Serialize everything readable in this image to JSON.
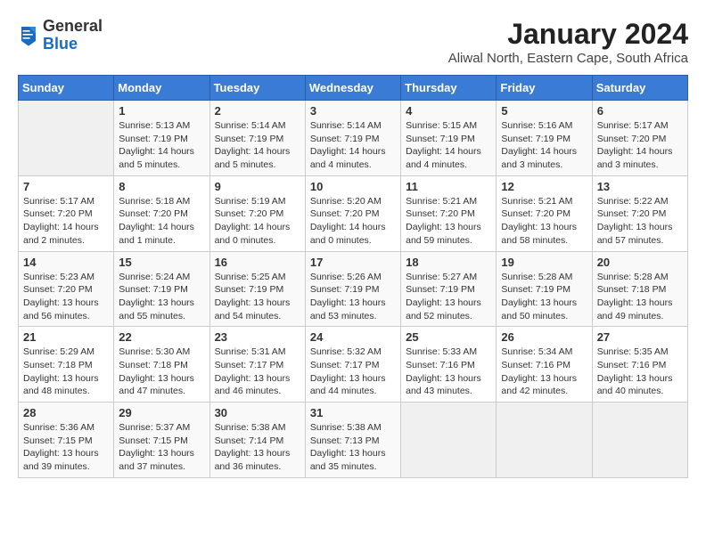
{
  "header": {
    "logo": {
      "line1": "General",
      "line2": "Blue"
    },
    "title": "January 2024",
    "location": "Aliwal North, Eastern Cape, South Africa"
  },
  "calendar": {
    "days_of_week": [
      "Sunday",
      "Monday",
      "Tuesday",
      "Wednesday",
      "Thursday",
      "Friday",
      "Saturday"
    ],
    "weeks": [
      [
        {
          "day": "",
          "info": ""
        },
        {
          "day": "1",
          "info": "Sunrise: 5:13 AM\nSunset: 7:19 PM\nDaylight: 14 hours\nand 5 minutes."
        },
        {
          "day": "2",
          "info": "Sunrise: 5:14 AM\nSunset: 7:19 PM\nDaylight: 14 hours\nand 5 minutes."
        },
        {
          "day": "3",
          "info": "Sunrise: 5:14 AM\nSunset: 7:19 PM\nDaylight: 14 hours\nand 4 minutes."
        },
        {
          "day": "4",
          "info": "Sunrise: 5:15 AM\nSunset: 7:19 PM\nDaylight: 14 hours\nand 4 minutes."
        },
        {
          "day": "5",
          "info": "Sunrise: 5:16 AM\nSunset: 7:19 PM\nDaylight: 14 hours\nand 3 minutes."
        },
        {
          "day": "6",
          "info": "Sunrise: 5:17 AM\nSunset: 7:20 PM\nDaylight: 14 hours\nand 3 minutes."
        }
      ],
      [
        {
          "day": "7",
          "info": "Sunrise: 5:17 AM\nSunset: 7:20 PM\nDaylight: 14 hours\nand 2 minutes."
        },
        {
          "day": "8",
          "info": "Sunrise: 5:18 AM\nSunset: 7:20 PM\nDaylight: 14 hours\nand 1 minute."
        },
        {
          "day": "9",
          "info": "Sunrise: 5:19 AM\nSunset: 7:20 PM\nDaylight: 14 hours\nand 0 minutes."
        },
        {
          "day": "10",
          "info": "Sunrise: 5:20 AM\nSunset: 7:20 PM\nDaylight: 14 hours\nand 0 minutes."
        },
        {
          "day": "11",
          "info": "Sunrise: 5:21 AM\nSunset: 7:20 PM\nDaylight: 13 hours\nand 59 minutes."
        },
        {
          "day": "12",
          "info": "Sunrise: 5:21 AM\nSunset: 7:20 PM\nDaylight: 13 hours\nand 58 minutes."
        },
        {
          "day": "13",
          "info": "Sunrise: 5:22 AM\nSunset: 7:20 PM\nDaylight: 13 hours\nand 57 minutes."
        }
      ],
      [
        {
          "day": "14",
          "info": "Sunrise: 5:23 AM\nSunset: 7:20 PM\nDaylight: 13 hours\nand 56 minutes."
        },
        {
          "day": "15",
          "info": "Sunrise: 5:24 AM\nSunset: 7:19 PM\nDaylight: 13 hours\nand 55 minutes."
        },
        {
          "day": "16",
          "info": "Sunrise: 5:25 AM\nSunset: 7:19 PM\nDaylight: 13 hours\nand 54 minutes."
        },
        {
          "day": "17",
          "info": "Sunrise: 5:26 AM\nSunset: 7:19 PM\nDaylight: 13 hours\nand 53 minutes."
        },
        {
          "day": "18",
          "info": "Sunrise: 5:27 AM\nSunset: 7:19 PM\nDaylight: 13 hours\nand 52 minutes."
        },
        {
          "day": "19",
          "info": "Sunrise: 5:28 AM\nSunset: 7:19 PM\nDaylight: 13 hours\nand 50 minutes."
        },
        {
          "day": "20",
          "info": "Sunrise: 5:28 AM\nSunset: 7:18 PM\nDaylight: 13 hours\nand 49 minutes."
        }
      ],
      [
        {
          "day": "21",
          "info": "Sunrise: 5:29 AM\nSunset: 7:18 PM\nDaylight: 13 hours\nand 48 minutes."
        },
        {
          "day": "22",
          "info": "Sunrise: 5:30 AM\nSunset: 7:18 PM\nDaylight: 13 hours\nand 47 minutes."
        },
        {
          "day": "23",
          "info": "Sunrise: 5:31 AM\nSunset: 7:17 PM\nDaylight: 13 hours\nand 46 minutes."
        },
        {
          "day": "24",
          "info": "Sunrise: 5:32 AM\nSunset: 7:17 PM\nDaylight: 13 hours\nand 44 minutes."
        },
        {
          "day": "25",
          "info": "Sunrise: 5:33 AM\nSunset: 7:16 PM\nDaylight: 13 hours\nand 43 minutes."
        },
        {
          "day": "26",
          "info": "Sunrise: 5:34 AM\nSunset: 7:16 PM\nDaylight: 13 hours\nand 42 minutes."
        },
        {
          "day": "27",
          "info": "Sunrise: 5:35 AM\nSunset: 7:16 PM\nDaylight: 13 hours\nand 40 minutes."
        }
      ],
      [
        {
          "day": "28",
          "info": "Sunrise: 5:36 AM\nSunset: 7:15 PM\nDaylight: 13 hours\nand 39 minutes."
        },
        {
          "day": "29",
          "info": "Sunrise: 5:37 AM\nSunset: 7:15 PM\nDaylight: 13 hours\nand 37 minutes."
        },
        {
          "day": "30",
          "info": "Sunrise: 5:38 AM\nSunset: 7:14 PM\nDaylight: 13 hours\nand 36 minutes."
        },
        {
          "day": "31",
          "info": "Sunrise: 5:38 AM\nSunset: 7:13 PM\nDaylight: 13 hours\nand 35 minutes."
        },
        {
          "day": "",
          "info": ""
        },
        {
          "day": "",
          "info": ""
        },
        {
          "day": "",
          "info": ""
        }
      ]
    ]
  }
}
